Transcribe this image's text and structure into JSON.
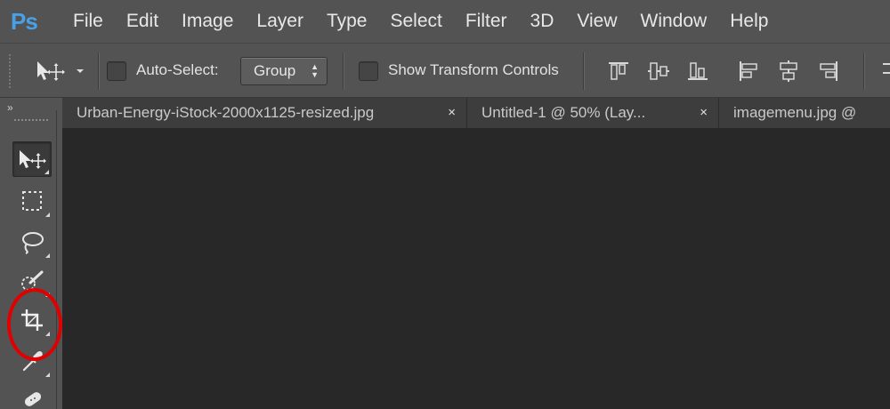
{
  "app": {
    "logo": "Ps"
  },
  "menu": [
    "File",
    "Edit",
    "Image",
    "Layer",
    "Type",
    "Select",
    "Filter",
    "3D",
    "View",
    "Window",
    "Help"
  ],
  "options_bar": {
    "auto_select_label": "Auto-Select:",
    "auto_select_value": "Group",
    "show_transform_label": "Show Transform Controls"
  },
  "tabs": [
    {
      "title": "Urban-Energy-iStock-2000x1125-resized.jpg",
      "close": "×"
    },
    {
      "title": "Untitled-1 @ 50% (Lay...",
      "close": "×"
    },
    {
      "title": "imagemenu.jpg @",
      "close": ""
    }
  ],
  "panel": {
    "collapse_glyph": "»"
  },
  "tools": [
    {
      "name": "move-tool",
      "icon": "move-icon",
      "active": true
    },
    {
      "name": "rectangular-marquee-tool",
      "icon": "marquee-icon",
      "active": false
    },
    {
      "name": "lasso-tool",
      "icon": "lasso-icon",
      "active": false
    },
    {
      "name": "quick-selection-tool",
      "icon": "quick-selection-icon",
      "active": false
    },
    {
      "name": "crop-tool",
      "icon": "crop-icon",
      "active": false
    },
    {
      "name": "eyedropper-tool",
      "icon": "eyedropper-icon",
      "active": false
    },
    {
      "name": "healing-brush-tool",
      "icon": "healing-brush-icon",
      "active": false
    }
  ],
  "colors": {
    "menubar": "#535353",
    "canvas": "#282828",
    "logo": "#4aa0e6",
    "highlight_circle": "#e00000"
  }
}
